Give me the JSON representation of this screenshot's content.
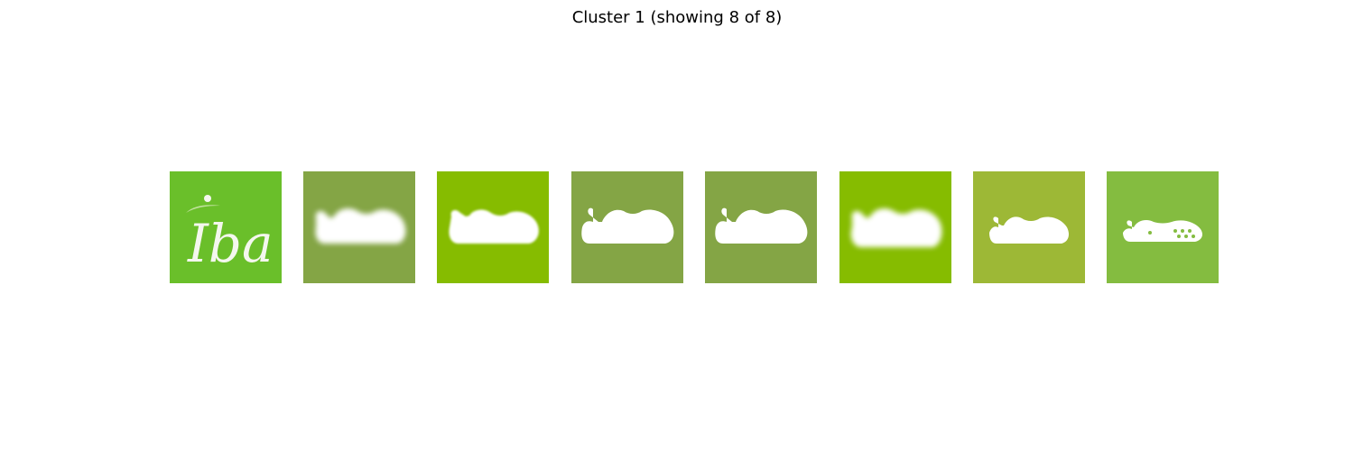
{
  "title": "Cluster 1 (showing 8 of 8)",
  "thumbnails": [
    {
      "name": "logo-iba",
      "logo_text": "Iba",
      "color": "#6abf2a"
    },
    {
      "name": "clog-silhouette",
      "color": "#84a545"
    },
    {
      "name": "clog-silhouette",
      "color": "#86bc00"
    },
    {
      "name": "clog-silhouette",
      "color": "#84a545"
    },
    {
      "name": "clog-silhouette",
      "color": "#84a545"
    },
    {
      "name": "clog-silhouette",
      "color": "#86bc00"
    },
    {
      "name": "clog-silhouette",
      "color": "#9db836"
    },
    {
      "name": "crocs-clog-silhouette",
      "color": "#84bc40"
    }
  ]
}
